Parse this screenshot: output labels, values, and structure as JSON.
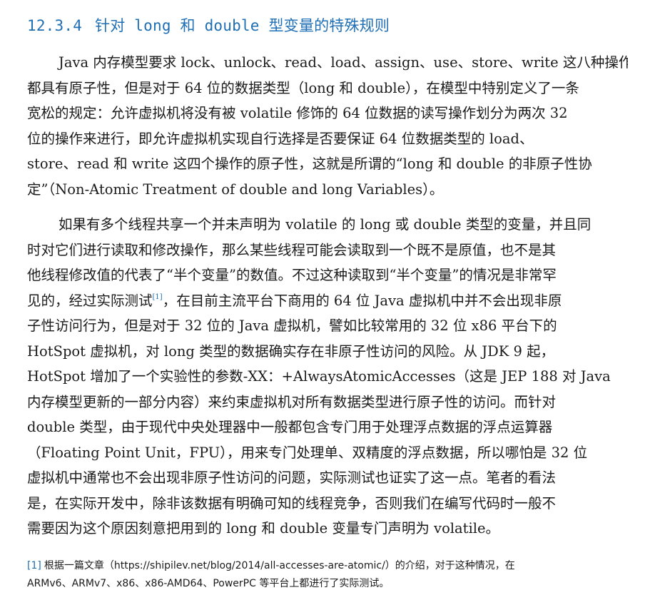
{
  "section": {
    "number": "12.3.4",
    "title": "针对 long 和 double 型变量的特殊规则"
  },
  "paragraph1": {
    "lines": [
      "Java 内存模型要求 lock、unlock、read、load、assign、use、store、write 这八种操作",
      "都具有原子性，但是对于 64 位的数据类型（long 和 double），在模型中特别定义了一条",
      "宽松的规定：允许虚拟机将没有被 volatile 修饰的 64 位数据的读写操作划分为两次 32",
      "位的操作来进行，即允许虚拟机实现自行选择是否要保证 64 位数据类型的 load、",
      "store、read 和 write 这四个操作的原子性，这就是所谓的“long 和 double 的非原子性协",
      "定”（Non-Atomic Treatment of double and long Variables）。"
    ]
  },
  "paragraph2": {
    "lines_before_ref": [
      "如果有多个线程共享一个并未声明为 volatile 的 long 或 double 类型的变量，并且同",
      "时对它们进行读取和修改操作，那么某些线程可能会读取到一个既不是原值，也不是其",
      "他线程修改值的代表了“半个变量”的数值。不过这种读取到“半个变量”的情况是非常罕"
    ],
    "ref_line_start": "见的，经过实际测试",
    "ref_mark": "[1]",
    "ref_line_end": "，在目前主流平台下商用的 64 位 Java 虚拟机中并不会出现非原",
    "lines_after_ref": [
      "子性访问行为，但是对于 32 位的 Java 虚拟机，譬如比较常用的 32 位 x86 平台下的",
      "HotSpot 虚拟机，对 long 类型的数据确实存在非原子性访问的风险。从 JDK 9 起，",
      "HotSpot 增加了一个实验性的参数-XX：+AlwaysAtomicAccesses（这是 JEP 188 对 Java",
      "内存模型更新的一部分内容）来约束虚拟机对所有数据类型进行原子性的访问。而针对",
      "double 类型，由于现代中央处理器中一般都包含专门用于处理浮点数据的浮点运算器",
      "（Floating Point Unit，FPU），用来专门处理单、双精度的浮点数据，所以哪怕是 32 位",
      "虚拟机中通常也不会出现非原子性访问的问题，实际测试也证实了这一点。笔者的看法",
      "是，在实际开发中，除非该数据有明确可知的线程竞争，否则我们在编写代码时一般不",
      "需要因为这个原因刻意把用到的 long 和 double 变量专门声明为 volatile。"
    ]
  },
  "footnote": {
    "mark": "[1]",
    "line1": "根据一篇文章（https://shipilev.net/blog/2014/all-accesses-are-atomic/）的介绍，对于这种情况，在",
    "line2": "ARMv6、ARMv7、x86、x86-AMD64、PowerPC 等平台上都进行了实际测试。"
  },
  "colors": {
    "heading": "#1f6fb5",
    "text": "#1a1a1a",
    "footnote_mark": "#1f6fb5"
  }
}
